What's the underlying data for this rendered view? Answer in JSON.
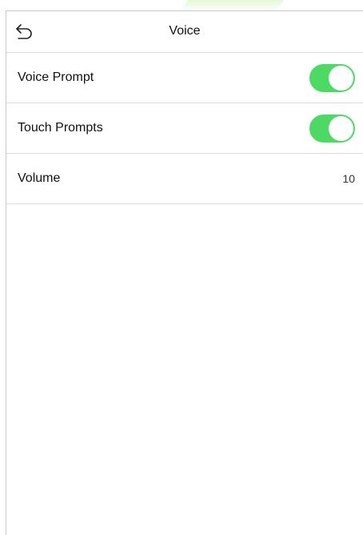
{
  "header": {
    "title": "Voice",
    "back_icon": "back-arrow-icon"
  },
  "settings": [
    {
      "label": "Voice Prompt",
      "type": "toggle",
      "enabled": true
    },
    {
      "label": "Touch Prompts",
      "type": "toggle",
      "enabled": true
    },
    {
      "label": "Volume",
      "type": "value",
      "value": "10"
    }
  ],
  "colors": {
    "toggle_on": "#4cd964",
    "divider": "#dcdcdc"
  }
}
